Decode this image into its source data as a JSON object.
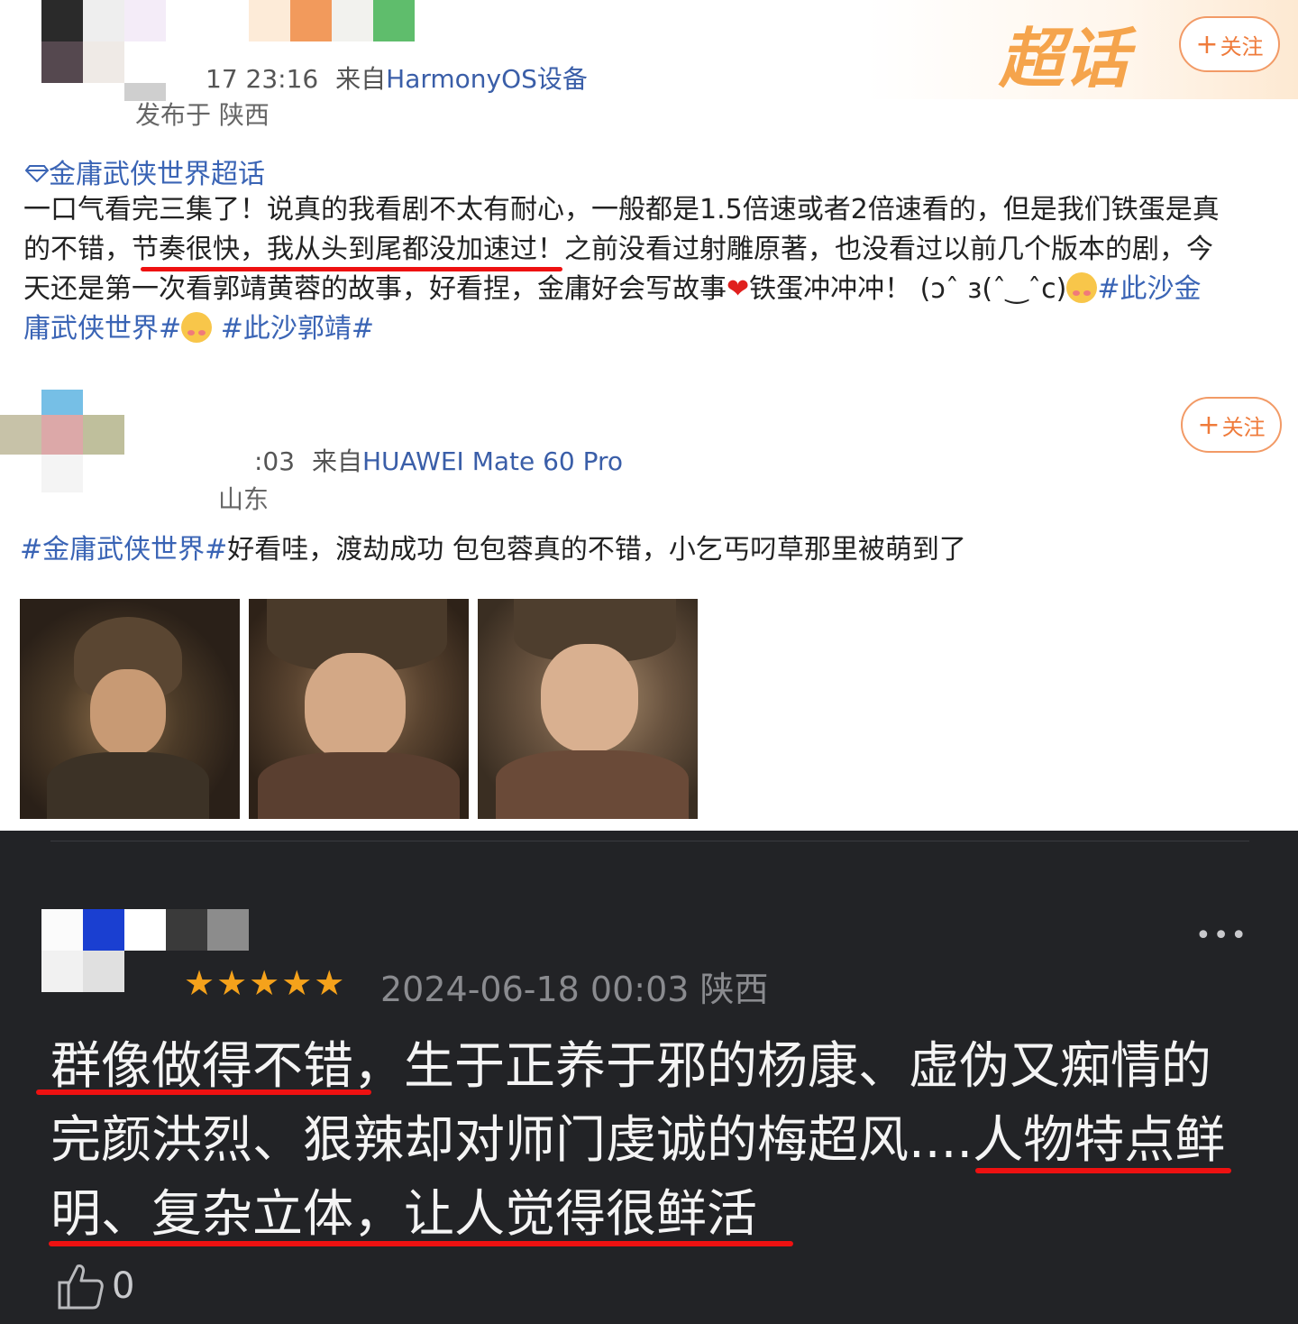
{
  "post1": {
    "time_partial": "17 23:16",
    "source_prefix": "来自",
    "source": "HarmonyOS设备",
    "location": "发布于 陕西",
    "supertopic_logo": "超话",
    "follow": "关注",
    "topic_link": "金庸武侠世界超话",
    "text_line1": "一口气看完三集了！说真的我看剧不太有耐心，一般都是1.5倍速或者2倍速看的，但是我们铁蛋是真",
    "text_line2_a": "的不错，",
    "text_line2_b": "节奏很快，我从头到尾都没加速过",
    "text_line2_c": "！之前没看过射雕原著，也没看过以前几个版本的剧，今",
    "text_line3_a": "天还是第一次看郭靖黄蓉的故事，好看捏，金庸好会写故事",
    "text_line3_b": "铁蛋冲冲冲！ (ɔˆ з(ˆ‿ˆc)",
    "text_line3_tag": "#此沙金",
    "text_line4_tag": "庸武侠世界#",
    "text_line4_tag2": "#此沙郭靖#"
  },
  "post2": {
    "time_partial": ":03",
    "source_prefix": "来自",
    "source": "HUAWEI Mate 60 Pro",
    "location": "山东",
    "follow": "关注",
    "tag": "#金庸武侠世界#",
    "text": "好看哇，渡劫成功 包包蓉真的不错，小乞丐叼草那里被萌到了",
    "images": [
      "image-1",
      "image-2",
      "image-3"
    ]
  },
  "comment": {
    "rating_stars": "★★★★★",
    "date": "2024-06-18 00:03 陕西",
    "more": "•••",
    "line1": "群像做得不错，生于正养于邪的杨康、虚伪又痴情的",
    "line2": "完颜洪烈、狠辣却对师门虔诚的梅超风....人物特点鲜",
    "line3": "明、复杂立体，让人觉得很鲜活",
    "likes": "0"
  },
  "colors": {
    "link": "#3a64b5",
    "follow": "#ef7b3b",
    "underline": "#e11111",
    "star": "#f5a21b",
    "dark_bg": "#222326"
  }
}
